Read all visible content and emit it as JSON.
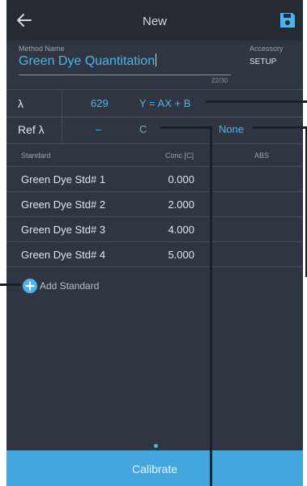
{
  "header": {
    "title": "New"
  },
  "method": {
    "label": "Method Name",
    "value": "Green Dye Quantitation",
    "counter": "22/30"
  },
  "accessory": {
    "label": "Accessory",
    "value": "SETUP"
  },
  "wavelength": {
    "label": "λ",
    "value": "629",
    "equation": "Y = AX + B"
  },
  "ref_wavelength": {
    "label": "Ref λ",
    "value": "–",
    "unit": "C",
    "option": "None"
  },
  "table": {
    "headers": [
      "Standard",
      "Conc [C]",
      "ABS"
    ],
    "rows": [
      {
        "name": "Green Dye Std# 1",
        "conc": "0.000"
      },
      {
        "name": "Green Dye Std# 2",
        "conc": "2.000"
      },
      {
        "name": "Green Dye Std# 3",
        "conc": "4.000"
      },
      {
        "name": "Green Dye Std# 4",
        "conc": "5.000"
      }
    ]
  },
  "add_standard": {
    "label": "Add Standard"
  },
  "calibrate": {
    "label": "Calibrate"
  },
  "colors": {
    "background": "#2f3641",
    "topbar": "#262b33",
    "accent": "#49b4ee",
    "calibrate_button": "#45a6dd"
  },
  "icons": [
    "back-arrow-icon",
    "save-icon",
    "add-circle-icon"
  ]
}
